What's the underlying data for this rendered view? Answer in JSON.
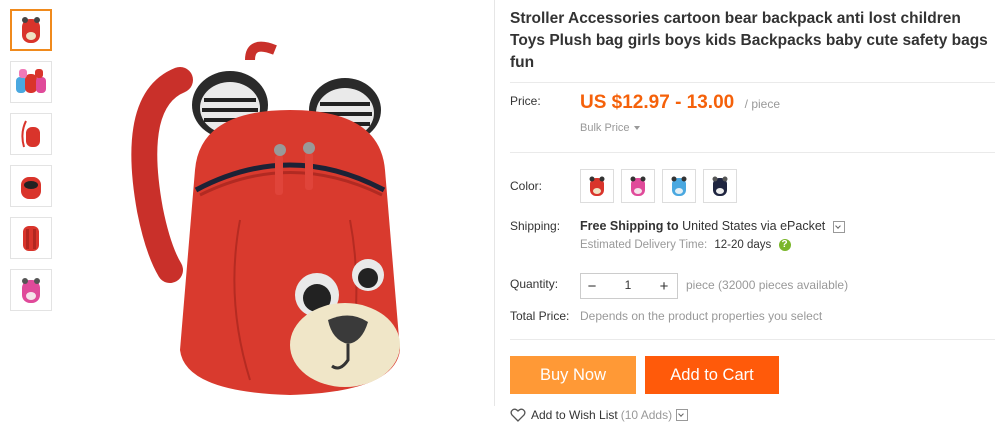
{
  "product": {
    "title": "Stroller Accessories cartoon bear backpack anti lost children Toys Plush bag girls boys kids Backpacks baby cute safety bags fun"
  },
  "thumbnails": [
    {
      "color": "red"
    },
    {
      "color": "group"
    },
    {
      "color": "red-side"
    },
    {
      "color": "red-open"
    },
    {
      "color": "red-back"
    },
    {
      "color": "pink"
    }
  ],
  "price": {
    "label": "Price:",
    "value": "US $12.97 - 13.00",
    "unit": "/ piece",
    "bulk_label": "Bulk Price"
  },
  "color": {
    "label": "Color:",
    "options": [
      "red",
      "pink",
      "blue",
      "navy"
    ]
  },
  "shipping": {
    "label": "Shipping:",
    "free_text": "Free Shipping to",
    "country": "United States",
    "via_text": "via ePacket",
    "est_label": "Estimated Delivery Time:",
    "est_days": "12-20 days",
    "help_icon": "?"
  },
  "quantity": {
    "label": "Quantity:",
    "minus": "−",
    "value": "1",
    "plus": "+",
    "note": "piece (32000 pieces available)"
  },
  "total": {
    "label": "Total Price:",
    "note": "Depends on the product properties you select"
  },
  "actions": {
    "buy_now": "Buy Now",
    "add_to_cart": "Add to Cart",
    "wish_label": "Add to Wish List",
    "wish_count": "(10 Adds)"
  },
  "colors": {
    "price": "#f5610a",
    "buy_now": "#ff9936",
    "add_to_cart": "#ff5a0a",
    "thumb_active_border": "#f08a1c"
  }
}
